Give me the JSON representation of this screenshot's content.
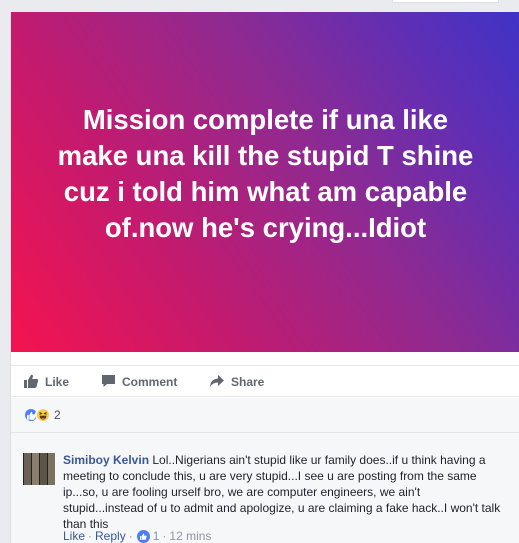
{
  "post": {
    "text": "Mission complete if una like make una kill the stupid T shine cuz i told him what am capable of.now he's crying...Idiot",
    "background_gradient": [
      "#f5134f",
      "#8e2a92",
      "#3f33c6"
    ]
  },
  "actions": {
    "like_label": "Like",
    "comment_label": "Comment",
    "share_label": "Share"
  },
  "reactions": {
    "types": [
      "like-icon",
      "haha-icon"
    ],
    "count": "2"
  },
  "comment": {
    "author": "Simiboy Kelvin",
    "text": "Lol..Nigerians ain't stupid like ur family does..if u think having a meeting to conclude this, u are very stupid...I see u are posting from the same ip...so, u are fooling urself bro, we are computer engineers, we ain't stupid...instead of u to admit and apologize, u are claiming a fake hack..I won't talk than this",
    "like_label": "Like",
    "separator": "·",
    "reply_label": "Reply",
    "like_count": "1",
    "time": "12 mins"
  }
}
